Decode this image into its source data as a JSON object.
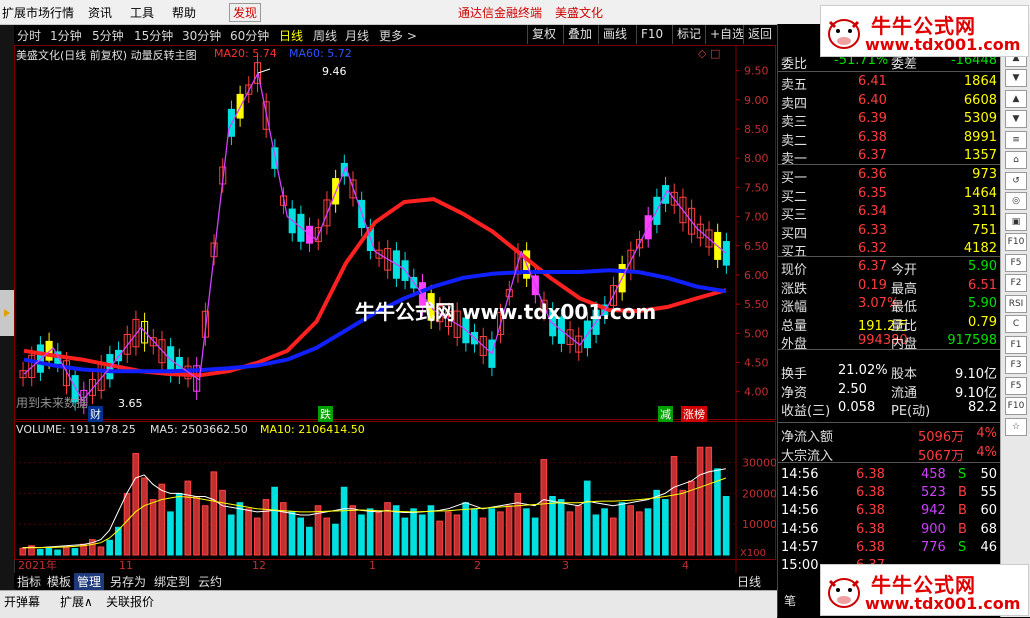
{
  "menu": {
    "items": [
      "扩展市场行情",
      "资讯",
      "工具",
      "帮助",
      "发现"
    ],
    "center_items": [
      "通达信金融终端",
      "美盛文化"
    ]
  },
  "periods": [
    "分时",
    "1分钟",
    "5分钟",
    "15分钟",
    "30分钟",
    "60分钟",
    "日线",
    "周线",
    "月线",
    "更多 >"
  ],
  "active_period": "日线",
  "toolbar": [
    "复权",
    "叠加",
    "画线",
    "F10",
    "标记",
    "+自选",
    "返回"
  ],
  "chart_header": {
    "title": "美盛文化(日线 前复权) 动量反转主图",
    "ma20": "MA20: 5.74",
    "ma60": "MA60: 5.72"
  },
  "chart_annotations": {
    "high": "9.46",
    "low": "3.65",
    "future": "用到未来数据",
    "center_watermark": "牛牛公式网  www.tdx001.com",
    "tags": [
      "财",
      "跌",
      "减",
      "涨榜"
    ]
  },
  "volume_header": {
    "volume": "VOLUME: 1911978.25",
    "ma5": "MA5: 2503662.50",
    "ma10": "MA10: 2106414.50"
  },
  "chart_data": [
    {
      "type": "line",
      "title": "美盛文化(日线 前复权) 动量反转主图",
      "ylim": [
        3.6,
        9.7
      ],
      "y_ticks": [
        4.0,
        4.5,
        5.0,
        5.5,
        6.0,
        6.5,
        7.0,
        7.5,
        8.0,
        8.5,
        9.0,
        9.5
      ],
      "x_ticks": [
        "2021年",
        "11",
        "12",
        "1",
        "2",
        "3",
        "4"
      ],
      "series": [
        {
          "name": "MA20",
          "color": "#ff2020",
          "values": [
            4.7,
            4.62,
            4.55,
            4.45,
            4.35,
            4.3,
            4.28,
            4.35,
            4.5,
            4.7,
            5.2,
            6.2,
            6.9,
            7.25,
            7.3,
            7.05,
            6.75,
            6.35,
            5.95,
            5.6,
            5.4,
            5.38,
            5.45,
            5.6,
            5.74
          ]
        },
        {
          "name": "MA60",
          "color": "#1020ff",
          "values": [
            4.55,
            4.45,
            4.38,
            4.35,
            4.35,
            4.35,
            4.37,
            4.4,
            4.45,
            4.55,
            4.75,
            5.05,
            5.35,
            5.6,
            5.8,
            5.95,
            6.02,
            6.05,
            6.05,
            6.05,
            6.08,
            6.05,
            5.95,
            5.8,
            5.72
          ]
        },
        {
          "name": "周期连线",
          "color": "#d040ff",
          "values": [
            4.3,
            4.75,
            3.85,
            4.45,
            5.1,
            4.55,
            4.2,
            8.5,
            9.46,
            7.0,
            6.6,
            7.85,
            6.4,
            6.1,
            5.4,
            5.1,
            4.65,
            6.4,
            5.2,
            4.8,
            5.5,
            6.5,
            7.45,
            6.8,
            6.37
          ]
        }
      ]
    },
    {
      "type": "bar",
      "title": "VOLUME",
      "ylim": [
        0,
        38000
      ],
      "y_ticks": [
        10000,
        20000,
        30000
      ],
      "unit": "X100",
      "values": [
        2200,
        3000,
        1800,
        2500,
        1600,
        2800,
        2100,
        3500,
        5000,
        2600,
        4800,
        9000,
        20000,
        33000,
        25000,
        18000,
        23000,
        14000,
        20000,
        24000,
        19000,
        16000,
        27000,
        21000,
        13000,
        17000,
        15000,
        12000,
        18000,
        22000,
        17000,
        14000,
        12000,
        9000,
        16000,
        12000,
        10000,
        22000,
        16000,
        13000,
        15000,
        14000,
        17000,
        16000,
        12000,
        15000,
        13000,
        16000,
        11000,
        14000,
        13000,
        17000,
        15000,
        12000,
        15000,
        14000,
        16000,
        20000,
        15000,
        12000,
        31000,
        19000,
        18000,
        14000,
        16000,
        24000,
        13000,
        15000,
        12000,
        17000,
        16000,
        14000,
        15000,
        21000,
        18000,
        32000,
        21000,
        24000,
        35000,
        35000,
        28000,
        19000
      ],
      "ma5": [
        2400,
        2500,
        2400,
        2600,
        2800,
        3000,
        3200,
        3400,
        4000,
        5000,
        8000,
        14000,
        20000,
        25000,
        26000,
        23000,
        21000,
        20000,
        20000,
        19500,
        19000,
        19000,
        18000,
        16000,
        15500,
        15000,
        14500,
        14000,
        14200,
        14500,
        14000,
        13500,
        13000,
        13000,
        13500,
        14000,
        14500,
        15000,
        15000,
        14500,
        14200,
        14000,
        14500,
        14000,
        13800,
        13800,
        14000,
        14200,
        14500,
        15000,
        16000,
        17000,
        16000,
        15000,
        15500,
        16000,
        16500,
        17000,
        16500,
        16000,
        18000,
        17500,
        17000,
        16500,
        16000,
        17500,
        17000,
        16500,
        16000,
        16500,
        17000,
        17500,
        18000,
        19000,
        20000,
        22000,
        23000,
        24000,
        26000,
        27000,
        27500,
        28000
      ],
      "ma10": [
        2300,
        2350,
        2400,
        2450,
        2500,
        2600,
        2800,
        3000,
        3400,
        4000,
        5500,
        8000,
        11000,
        14000,
        16000,
        17000,
        18000,
        18500,
        19000,
        18800,
        18500,
        18000,
        17500,
        17000,
        16500,
        16000,
        15500,
        15000,
        14800,
        14600,
        14400,
        14200,
        14000,
        14000,
        14100,
        14200,
        14300,
        14400,
        14500,
        14600,
        14500,
        14400,
        14300,
        14200,
        14100,
        14000,
        14100,
        14200,
        14300,
        14400,
        14600,
        14800,
        15000,
        15200,
        15400,
        15600,
        15800,
        16000,
        16200,
        16400,
        16600,
        16800,
        17000,
        17000,
        17000,
        17200,
        17400,
        17500,
        17500,
        17600,
        17800,
        18000,
        18300,
        18600,
        19000,
        19500,
        20000,
        21000,
        22000,
        23000,
        24000,
        25000
      ]
    }
  ],
  "quote": {
    "weibi_label": "委比",
    "weibi": "-51.71%",
    "weicha_label": "委差",
    "weicha": "-16448",
    "asks": [
      {
        "label": "卖五",
        "price": "6.41",
        "vol": "1864"
      },
      {
        "label": "卖四",
        "price": "6.40",
        "vol": "6608"
      },
      {
        "label": "卖三",
        "price": "6.39",
        "vol": "5309"
      },
      {
        "label": "卖二",
        "price": "6.38",
        "vol": "8991"
      },
      {
        "label": "卖一",
        "price": "6.37",
        "vol": "1357"
      }
    ],
    "bids": [
      {
        "label": "买一",
        "price": "6.36",
        "vol": "973"
      },
      {
        "label": "买二",
        "price": "6.35",
        "vol": "1464"
      },
      {
        "label": "买三",
        "price": "6.34",
        "vol": "311"
      },
      {
        "label": "买四",
        "price": "6.33",
        "vol": "751"
      },
      {
        "label": "买五",
        "price": "6.32",
        "vol": "4182"
      }
    ],
    "stats": [
      {
        "l1": "现价",
        "v1": "6.37",
        "c1": "red",
        "l2": "今开",
        "v2": "5.90",
        "c2": "green"
      },
      {
        "l1": "涨跌",
        "v1": "0.19",
        "c1": "red",
        "l2": "最高",
        "v2": "6.51",
        "c2": "red"
      },
      {
        "l1": "涨幅",
        "v1": "3.07%",
        "c1": "red",
        "l2": "最低",
        "v2": "5.90",
        "c2": "green"
      },
      {
        "l1": "总量",
        "v1": "191.2万",
        "c1": "yellow",
        "l2": "量比",
        "v2": "0.79",
        "c2": "yellow"
      },
      {
        "l1": "外盘",
        "v1": "994380",
        "c1": "red",
        "l2": "内盘",
        "v2": "917598",
        "c2": "green"
      }
    ],
    "stats2": [
      {
        "l1": "换手",
        "v1": "21.02%",
        "l2": "股本",
        "v2": "9.10亿"
      },
      {
        "l1": "净资",
        "v1": "2.50",
        "l2": "流通",
        "v2": "9.10亿"
      },
      {
        "l1": "收益(三)",
        "v1": "0.058",
        "l2": "PE(动)",
        "v2": "82.2"
      }
    ],
    "flow": [
      {
        "label": "净流入额",
        "value": "5096万",
        "pct": "4%"
      },
      {
        "label": "大宗流入",
        "value": "5067万",
        "pct": "4%"
      }
    ],
    "ticks": [
      {
        "time": "14:56",
        "price": "6.38",
        "vol": "458",
        "side": "S",
        "n": "50"
      },
      {
        "time": "14:56",
        "price": "6.38",
        "vol": "523",
        "side": "B",
        "n": "55"
      },
      {
        "time": "14:56",
        "price": "6.38",
        "vol": "942",
        "side": "B",
        "n": "60"
      },
      {
        "time": "14:56",
        "price": "6.38",
        "vol": "900",
        "side": "B",
        "n": "68"
      },
      {
        "time": "14:57",
        "price": "6.38",
        "vol": "776",
        "side": "S",
        "n": "46"
      },
      {
        "time": "15:00",
        "price": "6.37",
        "vol": "",
        "side": "",
        "n": ""
      }
    ],
    "bottom_tab": "笔"
  },
  "right_icons": [
    "行",
    "▲",
    "▼",
    "▲",
    "▼",
    "≡",
    "⌂",
    "↺",
    "◎",
    "▣",
    "F10",
    "F5",
    "F2",
    "RSI",
    "C",
    "F1",
    "F3",
    "F5",
    "F10",
    "☆"
  ],
  "bottom_tabs": [
    "指标",
    "模板",
    "管理",
    "另存为",
    "绑定到",
    "云约"
  ],
  "active_bottom_tab": "管理",
  "bottom_period_label": "日线",
  "status_bar": [
    "开弹幕",
    "扩展∧",
    "关联报价"
  ],
  "watermark": {
    "title": "牛牛公式网",
    "url": "www.tdx001.com"
  }
}
